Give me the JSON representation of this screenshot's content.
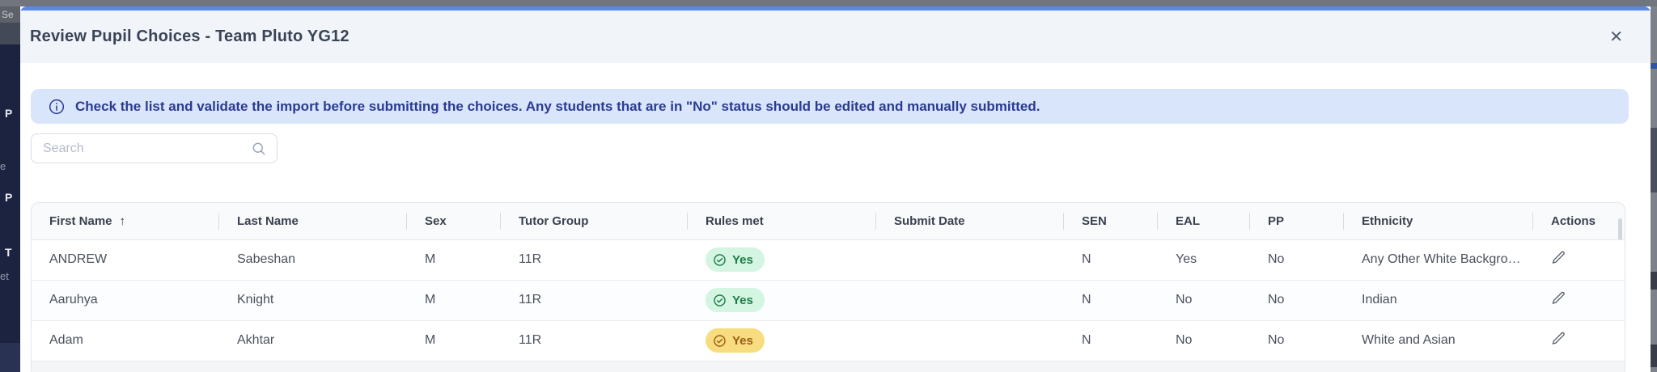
{
  "modal": {
    "title": "Review Pupil Choices - Team Pluto YG12",
    "close_icon": "✕",
    "banner": {
      "text": "Check the list and validate the import before submitting the choices. Any students that are in \"No\" status should be edited and manually submitted."
    },
    "search": {
      "placeholder": "Search",
      "value": ""
    }
  },
  "table": {
    "columns": [
      "First Name",
      "Last Name",
      "Sex",
      "Tutor Group",
      "Rules met",
      "Submit Date",
      "SEN",
      "EAL",
      "PP",
      "Ethnicity",
      "Actions"
    ],
    "sort": {
      "column": "First Name",
      "direction": "ascending"
    },
    "sort_icon": "↑",
    "rows": [
      {
        "first_name": "ANDREW",
        "last_name": "Sabeshan",
        "sex": "M",
        "tutor_group": "11R",
        "rules_met": "Yes",
        "rules_met_status": "success",
        "submit_date": "",
        "sen": "N",
        "eal": "Yes",
        "pp": "No",
        "ethnicity": "Any Other White Backgro…"
      },
      {
        "first_name": "Aaruhya",
        "last_name": "Knight",
        "sex": "M",
        "tutor_group": "11R",
        "rules_met": "Yes",
        "rules_met_status": "success",
        "submit_date": "",
        "sen": "N",
        "eal": "No",
        "pp": "No",
        "ethnicity": "Indian"
      },
      {
        "first_name": "Adam",
        "last_name": "Akhtar",
        "sex": "M",
        "tutor_group": "11R",
        "rules_met": "Yes",
        "rules_met_status": "warning",
        "submit_date": "",
        "sen": "N",
        "eal": "No",
        "pp": "No",
        "ethnicity": "White and Asian"
      }
    ]
  },
  "background": {
    "sidebar_fragments": {
      "tab": "Se",
      "item1": "P",
      "item2": "e",
      "item3": "P",
      "item4": "T",
      "item5": "et"
    }
  },
  "colors": {
    "accent_blue": "#5c86e8",
    "modal_header_bg": "#f1f4f9",
    "banner_bg": "#d9e5fa",
    "banner_text": "#2b3b92",
    "badge_success_bg": "#d4f5e1",
    "badge_success_text": "#1e7c49",
    "badge_warning_bg": "#f7dd80",
    "badge_warning_text": "#9c5a17",
    "sidebar_bg": "#1c2340",
    "overlay_gray": "#71757e"
  }
}
